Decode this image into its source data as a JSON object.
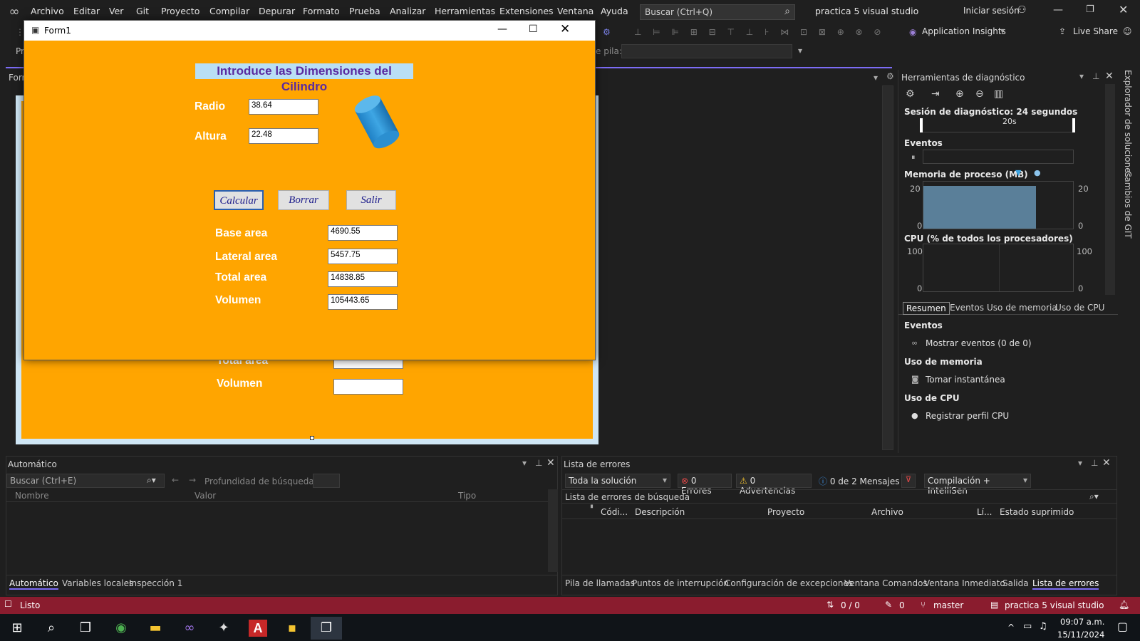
{
  "menu": {
    "items": [
      "Archivo",
      "Editar",
      "Ver",
      "Git",
      "Proyecto",
      "Compilar",
      "Depurar",
      "Formato",
      "Prueba",
      "Analizar",
      "Herramientas",
      "Extensiones",
      "Ventana",
      "Ayuda"
    ],
    "search_placeholder": "Buscar (Ctrl+Q)",
    "solution_name": "practica 5 visual studio",
    "sign_in": "Iniciar sesión"
  },
  "toolbar": {
    "app_insights": "Application Insights",
    "live_share": "Live Share",
    "stack_frame_label": "e pila:"
  },
  "designer": {
    "left_tab_label": "Forr",
    "left_label_pr": "Pr"
  },
  "form": {
    "title": "Form1",
    "heading": "Introduce las Dimensiones del Cilindro",
    "radio_label": "Radio",
    "radio_value": "38.64",
    "altura_label": "Altura",
    "altura_value": "22.48",
    "calcular": "Calcular",
    "borrar": "Borrar",
    "salir": "Salir",
    "base_area_label": "Base area",
    "base_area_value": "4690.55",
    "lateral_area_label": "Lateral area",
    "lateral_area_value": "5457.75",
    "total_area_label": "Total area",
    "total_area_value": "14838.85",
    "volumen_label": "Volumen",
    "volumen_value": "105443.65"
  },
  "designer_form_behind": {
    "total_area_label": "Total area",
    "volumen_label": "Volumen"
  },
  "diagnostics": {
    "title": "Herramientas de diagnóstico",
    "session": "Sesión de diagnóstico: 24 segundos",
    "timeline_tick": "20s",
    "events": "Eventos",
    "memory_title": "Memoria de proceso (MB)",
    "memory_max": "20",
    "memory_min": "0",
    "memory_max_right": "20",
    "memory_min_right": "0",
    "cpu_title": "CPU (% de todos los procesadores)",
    "cpu_max": "100",
    "cpu_min": "0",
    "cpu_max_right": "100",
    "cpu_min_right": "0",
    "tabs": [
      "Resumen",
      "Eventos",
      "Uso de memoria",
      "Uso de CPU"
    ],
    "section_events": "Eventos",
    "show_events": "Mostrar eventos (0 de 0)",
    "section_memory": "Uso de memoria",
    "snapshot": "Tomar instantánea",
    "section_cpu": "Uso de CPU",
    "cpu_profile": "Registrar perfil CPU"
  },
  "right_sidebar": {
    "solution_explorer": "Explorador de soluciones",
    "git_changes": "Cambios de GIT"
  },
  "autos": {
    "title": "Automático",
    "search_placeholder": "Buscar (Ctrl+E)",
    "depth_label": "Profundidad de búsqueda:",
    "col_name": "Nombre",
    "col_value": "Valor",
    "col_type": "Tipo",
    "tabs": [
      "Automático",
      "Variables locales",
      "Inspección 1"
    ]
  },
  "errors": {
    "title": "Lista de errores",
    "scope": "Toda la solución",
    "errors_count": "0 Errores",
    "warnings_count": "0 Advertencias",
    "messages_count": "0 de 2 Mensajes",
    "build_filter": "Compilación + IntelliSen",
    "search_placeholder": "Lista de errores de búsqueda",
    "col_code": "Códi...",
    "col_description": "Descripción",
    "col_project": "Proyecto",
    "col_file": "Archivo",
    "col_line": "Lí...",
    "col_suppressed": "Estado suprimido",
    "tabs": [
      "Pila de llamadas",
      "Puntos de interrupción",
      "Configuración de excepciones",
      "Ventana Comandos",
      "Ventana Inmediato",
      "Salida",
      "Lista de errores"
    ]
  },
  "status": {
    "ready": "Listo",
    "sync": "0 / 0",
    "pencil_count": "0",
    "branch": "master",
    "repo": "practica 5 visual studio"
  },
  "taskbar": {
    "time": "09:07 a.m.",
    "date": "15/11/2024"
  },
  "colors": {
    "form_bg": "#ffa500",
    "status_bar": "#8a1c2e",
    "heading_text": "#5a2aa0",
    "heading_bg": "#b9dff5"
  }
}
